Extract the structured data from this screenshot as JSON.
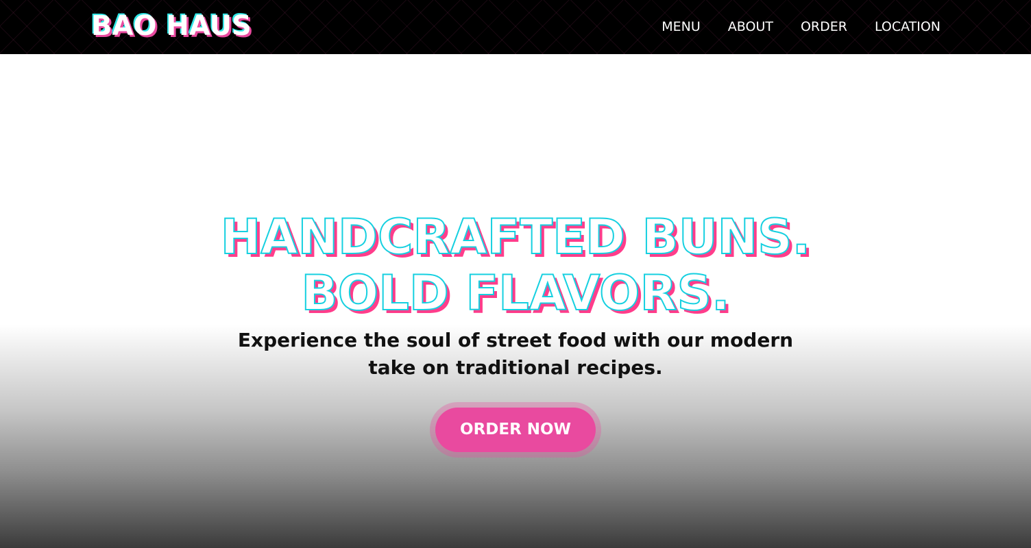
{
  "header": {
    "logo": "BAO HAUS",
    "nav": [
      {
        "label": "MENU"
      },
      {
        "label": "ABOUT"
      },
      {
        "label": "ORDER"
      },
      {
        "label": "LOCATION"
      }
    ]
  },
  "hero": {
    "headline_line1": "HANDCRAFTED BUNS.",
    "headline_line2": "BOLD FLAVORS.",
    "subtitle": "Experience the soul of street food with our modern take on traditional recipes.",
    "cta_label": "ORDER NOW"
  },
  "colors": {
    "accent_pink": "#e94a9f",
    "accent_cyan": "#2fe6e6",
    "header_bg": "#000000"
  }
}
